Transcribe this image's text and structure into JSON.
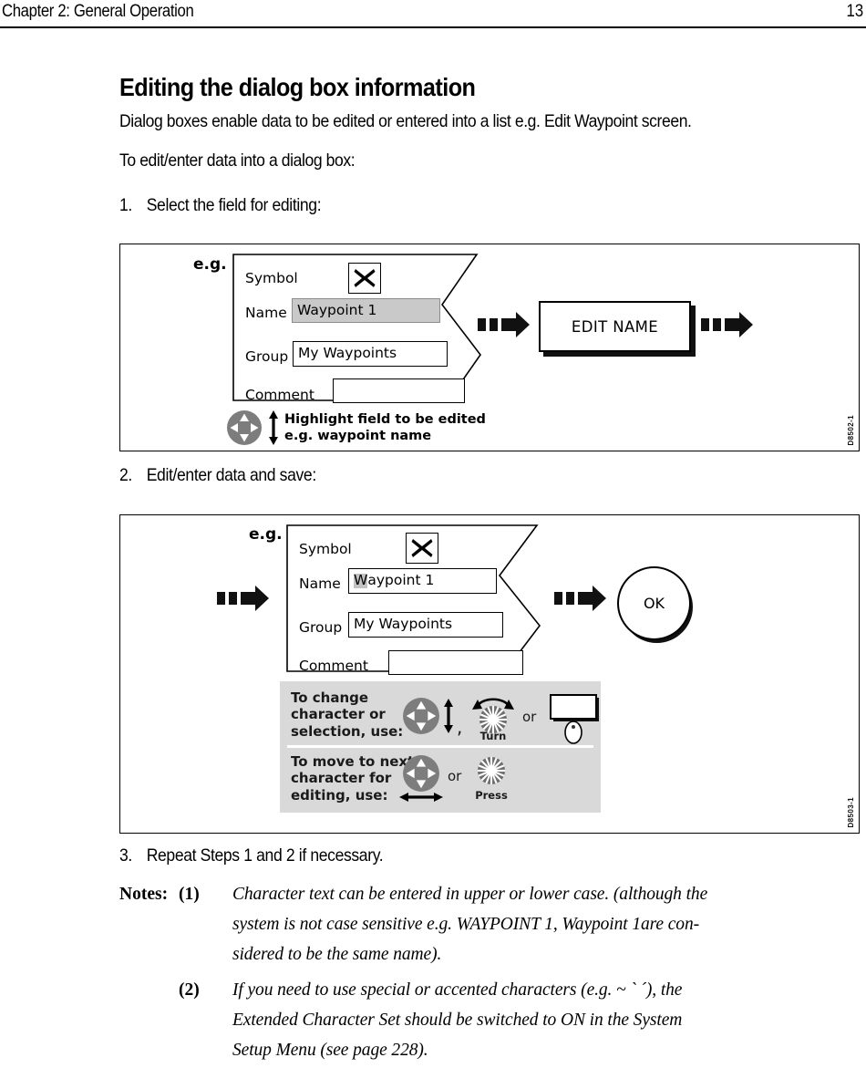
{
  "header": {
    "chapter_title": "Chapter 2: General Operation",
    "page_number": "13"
  },
  "heading": "Editing the dialog box information",
  "intro_paragraphs": [
    "Dialog boxes enable data to be edited or entered into a list e.g. Edit Waypoint screen.",
    "To edit/enter data into a dialog box:"
  ],
  "steps": [
    {
      "number": "1.",
      "text": "Select the field for editing:"
    },
    {
      "number": "2.",
      "text": "Edit/enter data and save:"
    },
    {
      "number": "3.",
      "text": "Repeat Steps 1 and 2 if necessary."
    }
  ],
  "figure1": {
    "id_code": "D8502-1",
    "eg_label": "e.g.",
    "dialog": {
      "rows": [
        {
          "label": "Symbol",
          "value": "",
          "type": "symbol"
        },
        {
          "label": "Name",
          "value": "Waypoint 1",
          "type": "selected"
        },
        {
          "label": "Group",
          "value": "My Waypoints",
          "type": "text"
        },
        {
          "label": "Comment",
          "value": "",
          "type": "text"
        }
      ],
      "symbol_glyph": "x-mark-icon"
    },
    "hint": {
      "line1": "Highlight field to be edited",
      "line2": "e.g. waypoint name"
    },
    "button_label": "EDIT NAME"
  },
  "figure2": {
    "id_code": "D8503-1",
    "eg_label": "e.g.",
    "dialog": {
      "rows": [
        {
          "label": "Symbol",
          "value": "",
          "type": "symbol"
        },
        {
          "label": "Name",
          "value": "Waypoint 1",
          "cursor_char": "W",
          "rest": "aypoint 1",
          "type": "editing"
        },
        {
          "label": "Group",
          "value": "My Waypoints",
          "type": "text"
        },
        {
          "label": "Comment",
          "value": "",
          "type": "text"
        }
      ],
      "symbol_glyph": "x-mark-icon"
    },
    "ok_label": "OK",
    "instructions": [
      {
        "label_lines": [
          "To change",
          "character or",
          "selection, use:"
        ],
        "separator": ",",
        "or_label": "or",
        "dial_caption": "Turn"
      },
      {
        "label_lines": [
          "To move to next",
          "character for",
          "editing, use:"
        ],
        "or_label": "or",
        "dial_caption": "Press"
      }
    ]
  },
  "notes": {
    "label": "Notes:",
    "items": [
      {
        "marker": "(1)",
        "lines": [
          "Character text can be entered in upper or lower case. (although the",
          "system is not case sensitive e.g. WAYPOINT 1, Waypoint 1are con-",
          "sidered to be the same name)."
        ]
      },
      {
        "marker": "(2)",
        "lines": [
          "If you need to use special or accented characters (e.g. ~ ` ´), the",
          "Extended Character Set should be switched to ON in the System",
          "Setup Menu (see page 228)."
        ]
      }
    ]
  },
  "colors": {
    "selected_field_bg": "#c9c9c9",
    "panel_bg": "#d9d9d9",
    "dpad_gray": "#7d7d7d",
    "dial_gray": "#6e6e6e"
  }
}
